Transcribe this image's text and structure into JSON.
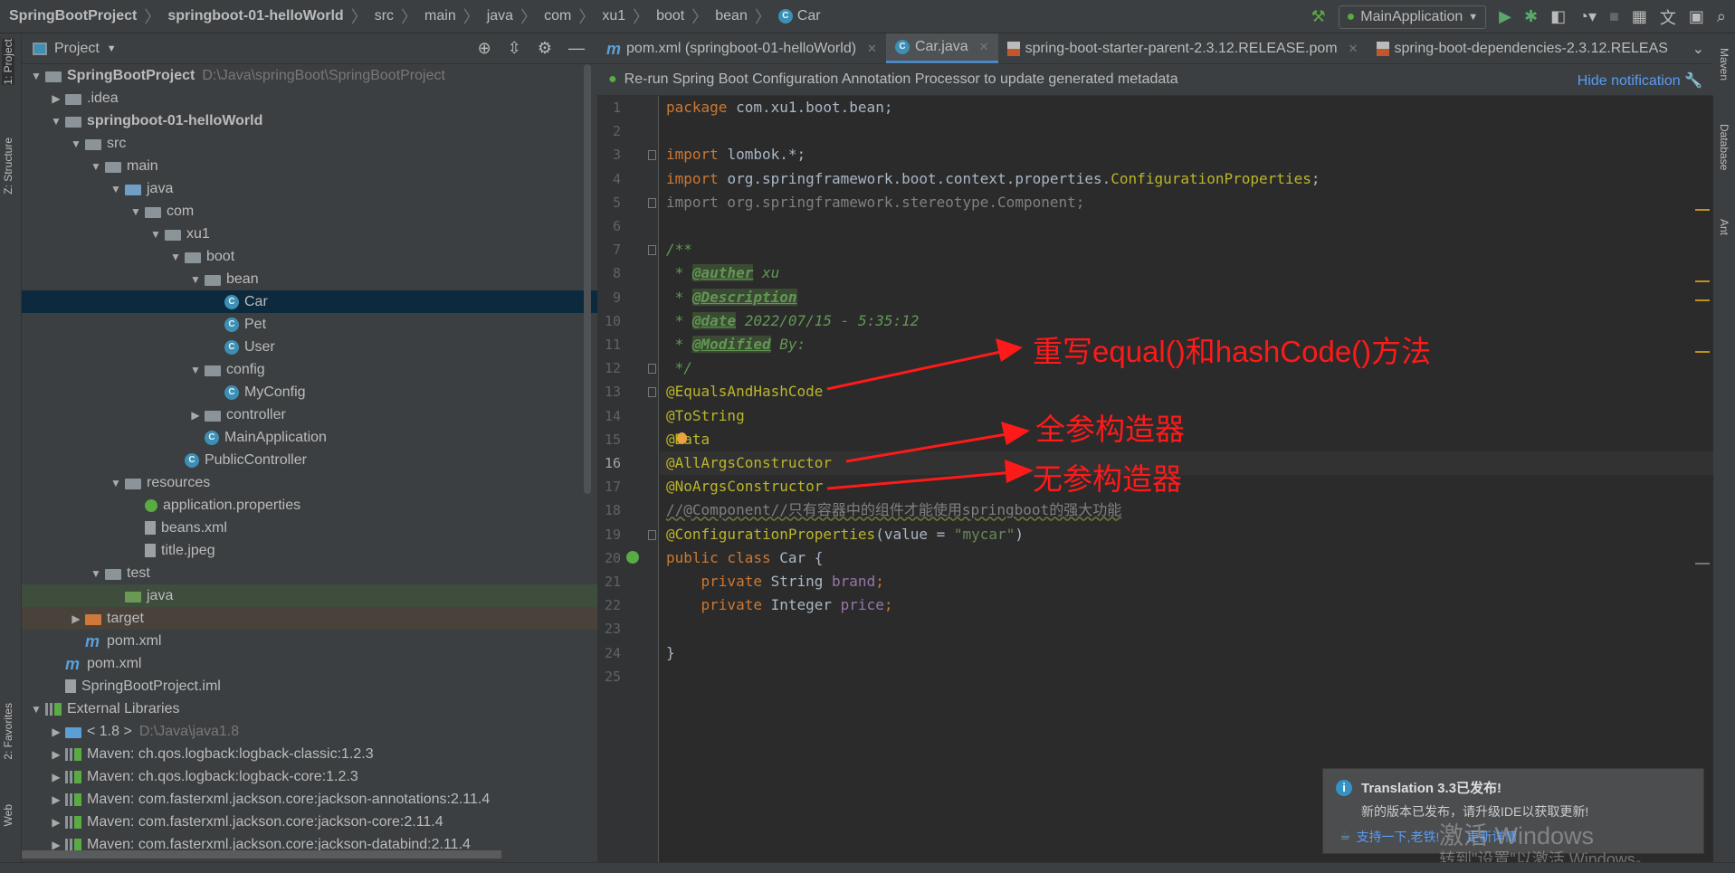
{
  "breadcrumb": [
    "SpringBootProject",
    "springboot-01-helloWorld",
    "src",
    "main",
    "java",
    "com",
    "xu1",
    "boot",
    "bean",
    "Car"
  ],
  "run_config": "MainApplication",
  "left_stripe": {
    "project": "1: Project",
    "structure": "Z: Structure",
    "favorites": "2: Favorites",
    "web": "Web"
  },
  "right_stripe": {
    "maven": "Maven",
    "database": "Database",
    "ant": "Ant"
  },
  "project_panel": {
    "title": "Project"
  },
  "tree": [
    {
      "label": "SpringBootProject",
      "extra": "D:\\Java\\springBoot\\SpringBootProject",
      "level": 0,
      "arrow": "down",
      "icon": "module",
      "bold": true
    },
    {
      "label": ".idea",
      "level": 1,
      "arrow": "right",
      "icon": "folder"
    },
    {
      "label": "springboot-01-helloWorld",
      "level": 1,
      "arrow": "down",
      "icon": "module",
      "bold": true
    },
    {
      "label": "src",
      "level": 2,
      "arrow": "down",
      "icon": "folder"
    },
    {
      "label": "main",
      "level": 3,
      "arrow": "down",
      "icon": "folder"
    },
    {
      "label": "java",
      "level": 4,
      "arrow": "down",
      "icon": "src-folder"
    },
    {
      "label": "com",
      "level": 5,
      "arrow": "down",
      "icon": "package"
    },
    {
      "label": "xu1",
      "level": 6,
      "arrow": "down",
      "icon": "package"
    },
    {
      "label": "boot",
      "level": 7,
      "arrow": "down",
      "icon": "package"
    },
    {
      "label": "bean",
      "level": 8,
      "arrow": "down",
      "icon": "package"
    },
    {
      "label": "Car",
      "level": 9,
      "icon": "class",
      "state": "selected"
    },
    {
      "label": "Pet",
      "level": 9,
      "icon": "class"
    },
    {
      "label": "User",
      "level": 9,
      "icon": "class"
    },
    {
      "label": "config",
      "level": 8,
      "arrow": "down",
      "icon": "package"
    },
    {
      "label": "MyConfig",
      "level": 9,
      "icon": "class"
    },
    {
      "label": "controller",
      "level": 8,
      "arrow": "right",
      "icon": "package"
    },
    {
      "label": "MainApplication",
      "level": 8,
      "icon": "spring-class"
    },
    {
      "label": "PublicController",
      "level": 7,
      "icon": "class"
    },
    {
      "label": "resources",
      "level": 4,
      "arrow": "down",
      "icon": "resources-folder"
    },
    {
      "label": "application.properties",
      "level": 5,
      "icon": "properties"
    },
    {
      "label": "beans.xml",
      "level": 5,
      "icon": "xml"
    },
    {
      "label": "title.jpeg",
      "level": 5,
      "icon": "image"
    },
    {
      "label": "test",
      "level": 3,
      "arrow": "down",
      "icon": "folder"
    },
    {
      "label": "java",
      "level": 4,
      "icon": "test-folder",
      "state": "test"
    },
    {
      "label": "target",
      "level": 2,
      "arrow": "right",
      "icon": "excluded-folder",
      "state": "excluded"
    },
    {
      "label": "pom.xml",
      "level": 2,
      "icon": "maven"
    },
    {
      "label": "pom.xml",
      "level": 1,
      "icon": "maven"
    },
    {
      "label": "SpringBootProject.iml",
      "level": 1,
      "icon": "iml"
    },
    {
      "label": "External Libraries",
      "level": 0,
      "arrow": "down",
      "icon": "libraries"
    },
    {
      "label": "< 1.8 >",
      "extra": "D:\\Java\\java1.8",
      "level": 1,
      "arrow": "right",
      "icon": "jdk"
    },
    {
      "label": "Maven: ch.qos.logback:logback-classic:1.2.3",
      "level": 1,
      "arrow": "right",
      "icon": "library"
    },
    {
      "label": "Maven: ch.qos.logback:logback-core:1.2.3",
      "level": 1,
      "arrow": "right",
      "icon": "library"
    },
    {
      "label": "Maven: com.fasterxml.jackson.core:jackson-annotations:2.11.4",
      "level": 1,
      "arrow": "right",
      "icon": "library"
    },
    {
      "label": "Maven: com.fasterxml.jackson.core:jackson-core:2.11.4",
      "level": 1,
      "arrow": "right",
      "icon": "library"
    },
    {
      "label": "Maven: com.fasterxml.jackson.core:jackson-databind:2.11.4",
      "level": 1,
      "arrow": "right",
      "icon": "library"
    }
  ],
  "tabs": [
    {
      "label": "pom.xml (springboot-01-helloWorld)",
      "icon": "maven",
      "active": false
    },
    {
      "label": "Car.java",
      "icon": "class",
      "active": true
    },
    {
      "label": "spring-boot-starter-parent-2.3.12.RELEASE.pom",
      "icon": "pom",
      "active": false
    },
    {
      "label": "spring-boot-dependencies-2.3.12.RELEAS",
      "icon": "pom",
      "active": false
    }
  ],
  "notification": {
    "text": "Re-run Spring Boot Configuration Annotation Processor to update generated metadata",
    "hide": "Hide notification"
  },
  "code_lines": [
    [
      [
        "kw",
        "package "
      ],
      [
        "",
        "com.xu1.boot.bean;"
      ]
    ],
    [],
    [
      [
        "kw",
        "import "
      ],
      [
        "",
        "lombok.*;"
      ]
    ],
    [
      [
        "kw",
        "import "
      ],
      [
        "",
        "org.springframework.boot.context.properties."
      ],
      [
        "an",
        "ConfigurationProperties"
      ],
      [
        "",
        "; "
      ]
    ],
    [
      [
        "gr",
        "import org.springframework.stereotype.Component;"
      ]
    ],
    [],
    [
      [
        "dc",
        "/**"
      ]
    ],
    [
      [
        "dc",
        " * "
      ],
      [
        "tag",
        "@auther"
      ],
      [
        "dc",
        " xu"
      ]
    ],
    [
      [
        "dc",
        " * "
      ],
      [
        "tag",
        "@Description"
      ]
    ],
    [
      [
        "dc",
        " * "
      ],
      [
        "tag",
        "@date"
      ],
      [
        "dc",
        " 2022/07/15 - 5:35:12"
      ]
    ],
    [
      [
        "dc",
        " * "
      ],
      [
        "tag",
        "@Modified"
      ],
      [
        "dc",
        " By:"
      ]
    ],
    [
      [
        "dc",
        " */"
      ]
    ],
    [
      [
        "an",
        "@EqualsAndHashCode"
      ]
    ],
    [
      [
        "an",
        "@ToString"
      ]
    ],
    [
      [
        "an",
        "@Data"
      ]
    ],
    [
      [
        "an",
        "@AllArgsConstructor"
      ]
    ],
    [
      [
        "an",
        "@NoArgsConstructor"
      ]
    ],
    [
      [
        "cm",
        "//@Component//只有容器中的组件才能使用springboot的强大功能"
      ]
    ],
    [
      [
        "an",
        "@ConfigurationProperties"
      ],
      [
        "",
        "(value = "
      ],
      [
        "st",
        "\"mycar\""
      ],
      [
        "",
        ")"
      ]
    ],
    [
      [
        "kw",
        "public class "
      ],
      [
        "",
        "Car {"
      ]
    ],
    [
      [
        "",
        "    "
      ],
      [
        "kw",
        "private "
      ],
      [
        "",
        "String "
      ],
      [
        "fd",
        "brand"
      ],
      [
        "kw",
        ";"
      ]
    ],
    [
      [
        "",
        "    "
      ],
      [
        "kw",
        "private "
      ],
      [
        "",
        "Integer "
      ],
      [
        "fd",
        "price"
      ],
      [
        "kw",
        ";"
      ]
    ],
    [],
    [
      [
        "",
        "}"
      ]
    ],
    []
  ],
  "current_line": 16,
  "annotations": {
    "equals": "重写equal()和hashCode()方法",
    "all_args": "全参构造器",
    "no_args": "无参构造器",
    "color": "#ff1a1a"
  },
  "toast": {
    "title": "Translation 3.3已发布!",
    "body": "新的版本已发布，请升级IDE以获取更新!",
    "link1": "支持一下,老铁!",
    "link2": "更新详情"
  },
  "watermark": {
    "line1": "激活 Windows",
    "line2": "转到\"设置\"以激活 Windows。"
  }
}
